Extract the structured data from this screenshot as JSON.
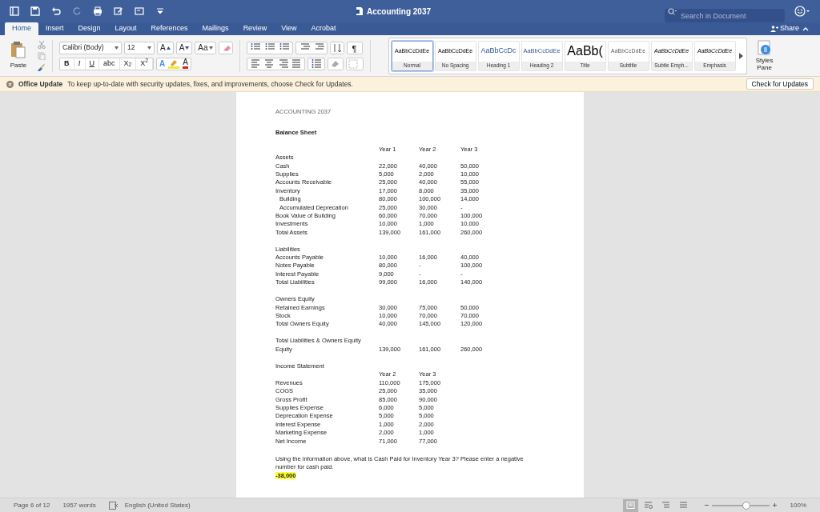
{
  "title": "Accounting 2037",
  "search": {
    "placeholder": "Search in Document"
  },
  "tabs": [
    {
      "label": "Home",
      "selected": true
    },
    {
      "label": "Insert",
      "selected": false
    },
    {
      "label": "Design",
      "selected": false
    },
    {
      "label": "Layout",
      "selected": false
    },
    {
      "label": "References",
      "selected": false
    },
    {
      "label": "Mailings",
      "selected": false
    },
    {
      "label": "Review",
      "selected": false
    },
    {
      "label": "View",
      "selected": false
    },
    {
      "label": "Acrobat",
      "selected": false
    }
  ],
  "share": "Share",
  "ribbon": {
    "paste": "Paste",
    "font_name": "Calibri (Body)",
    "font_size": "12",
    "font_tools": [
      {
        "label": "A",
        "kind": "grow"
      },
      {
        "label": "A",
        "kind": "shrink"
      },
      {
        "label": "Aa",
        "kind": "case"
      }
    ],
    "format_buttons": [
      "B",
      "I",
      "U",
      "abc",
      "X$_{2}$",
      "X$^{2}$"
    ],
    "color_tools": [
      {
        "label": "A",
        "kind": "effects"
      },
      {
        "label": "A",
        "kind": "fontcolor"
      }
    ],
    "paragraph_mark": "¶",
    "styles": [
      {
        "preview": "AaBbCcDdEe",
        "name": "Normal",
        "kind": "normal",
        "selected": true
      },
      {
        "preview": "AaBbCcDdEe",
        "name": "No Spacing",
        "kind": "normal",
        "selected": false
      },
      {
        "preview": "AaBbCcDc",
        "name": "Heading 1",
        "kind": "heading1",
        "selected": false
      },
      {
        "preview": "AaBbCcDdEe",
        "name": "Heading 2",
        "kind": "heading2",
        "selected": false
      },
      {
        "preview": "AaBb(",
        "name": "Title",
        "kind": "title",
        "selected": false
      },
      {
        "preview": "AaBbCcDdEe",
        "name": "Subtitle",
        "kind": "subtitle",
        "selected": false
      },
      {
        "preview": "AaBbCcDdEe",
        "name": "Subtle Emph...",
        "kind": "italic",
        "selected": false
      },
      {
        "preview": "AaBbCcDdEe",
        "name": "Emphasis",
        "kind": "italic",
        "selected": false
      }
    ],
    "styles_pane": "Styles Pane"
  },
  "update_bar": {
    "title": "Office Update",
    "message": "To keep up-to-date with security updates, fixes, and improvements, choose Check for Updates.",
    "button": "Check for Updates"
  },
  "document": {
    "header": "ACCOUNTING 2037",
    "title": "Balance Sheet",
    "balance_sheet": {
      "columns": [
        "Year 1",
        "Year 2",
        "Year 3"
      ],
      "groups": [
        {
          "heading": "Assets",
          "rows": [
            {
              "label": "Cash",
              "kind": "item",
              "values": [
                "22,000",
                "40,000",
                "50,000"
              ]
            },
            {
              "label": "Supplies",
              "kind": "item",
              "values": [
                "5,000",
                "2,000",
                "10,000"
              ]
            },
            {
              "label": "Accounts Receivable",
              "kind": "item",
              "values": [
                "25,000",
                "40,000",
                "55,000"
              ]
            },
            {
              "label": "Inventory",
              "kind": "item",
              "values": [
                "17,000",
                "8,000",
                "35,000"
              ]
            },
            {
              "label": "Building",
              "kind": "sub",
              "values": [
                "80,000",
                "100,000",
                "14,000"
              ]
            },
            {
              "label": "Accumulated Deprecation",
              "kind": "sub",
              "values": [
                "25,000",
                "30,000",
                "-"
              ]
            },
            {
              "label": "Book Value of Building",
              "kind": "item",
              "values": [
                "60,000",
                "70,000",
                "100,000"
              ]
            },
            {
              "label": "Investments",
              "kind": "item",
              "values": [
                "10,000",
                "1,000",
                "10,000"
              ]
            },
            {
              "label": "Total Assets",
              "kind": "item",
              "values": [
                "139,000",
                "161,000",
                "260,000"
              ]
            }
          ]
        },
        {
          "heading": "Liabilities",
          "rows": [
            {
              "label": "Accounts Payable",
              "kind": "item",
              "values": [
                "10,000",
                "16,000",
                "40,000"
              ]
            },
            {
              "label": "Notes Payable",
              "kind": "item",
              "values": [
                "80,000",
                "-",
                "100,000"
              ]
            },
            {
              "label": "Interest Payable",
              "kind": "item",
              "values": [
                "9,000",
                "-",
                "-"
              ]
            },
            {
              "label": "Total Liabilities",
              "kind": "item",
              "values": [
                "99,000",
                "16,000",
                "140,000"
              ]
            }
          ]
        },
        {
          "heading": "Owners Equity",
          "rows": [
            {
              "label": "Retained Earnings",
              "kind": "item",
              "values": [
                "30,000",
                "75,000",
                "50,000"
              ]
            },
            {
              "label": "Stock",
              "kind": "item",
              "values": [
                "10,000",
                "70,000",
                "70,000"
              ]
            },
            {
              "label": "Total Owners Equity",
              "kind": "item",
              "values": [
                "40,000",
                "145,000",
                "120,000"
              ]
            }
          ]
        },
        {
          "heading": "Total Liabilities & Owners Equity",
          "rows": [
            {
              "label": "Equity",
              "kind": "item",
              "values": [
                "139,000",
                "161,000",
                "260,000"
              ]
            }
          ]
        }
      ]
    },
    "income_statement": {
      "heading": "Income Statement",
      "columns": [
        "Year 2",
        "Year 3"
      ],
      "rows": [
        {
          "label": "Revenues",
          "values": [
            "110,000",
            "175,000"
          ]
        },
        {
          "label": "COGS",
          "values": [
            "25,000",
            "35,000"
          ]
        },
        {
          "label": "Gross Profit",
          "values": [
            "85,000",
            "90,000"
          ]
        },
        {
          "label": "Supplies Expense",
          "values": [
            "6,000",
            "5,000"
          ]
        },
        {
          "label": "Deprecation Expense",
          "values": [
            "5,000",
            "5,000"
          ]
        },
        {
          "label": "Interest Expense",
          "values": [
            "1,000",
            "2,000"
          ]
        },
        {
          "label": "Marketing Expense",
          "values": [
            "2,000",
            "1,000"
          ]
        },
        {
          "label": "Net Income",
          "values": [
            "71,000",
            "77,000"
          ]
        }
      ]
    },
    "question": "Using the information above, what is Cash Paid for Inventory Year 3? Please enter a negative number for cash paid.",
    "answer": "-38,000"
  },
  "status_bar": {
    "page": "Page 6 of 12",
    "words": "1957 words",
    "language": "English (United States)",
    "views": [
      {
        "kind": "print",
        "selected": true
      },
      {
        "kind": "web",
        "selected": false
      },
      {
        "kind": "outline",
        "selected": false
      },
      {
        "kind": "draft",
        "selected": false
      }
    ],
    "zoom_slider": {
      "level": 0.6
    },
    "zoom": "100%"
  }
}
